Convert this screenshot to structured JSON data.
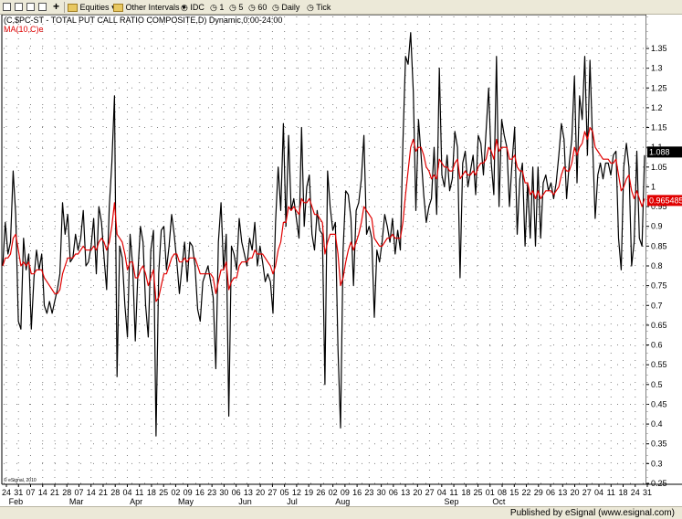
{
  "toolbar": {
    "equities": "Equities",
    "other_intervals": "Other Intervals",
    "idc": "IDC",
    "i1": "1",
    "i5": "5",
    "i60": "60",
    "daily": "Daily",
    "tick": "Tick"
  },
  "footer": {
    "published": "Published by eSignal (www.esignal.com)"
  },
  "colors": {
    "price": "#000000",
    "ma": "#e00000",
    "grid": "#808080"
  },
  "chart_data": {
    "type": "line",
    "title": "(C,$PC-ST - TOTAL PUT CALL RATIO COMPOSITE,D) Dynamic,0:00-24:00",
    "ma_label": "MA(10,C)e",
    "watermark": "© eSignal, 2010",
    "ylim": [
      0.25,
      1.4
    ],
    "y_ticks": [
      "0.25",
      "0.3",
      "0.35",
      "0.4",
      "0.45",
      "0.5",
      "0.55",
      "0.6",
      "0.65",
      "0.7",
      "0.75",
      "0.8",
      "0.85",
      "0.9",
      "0.95",
      "1",
      "1.05",
      "1.1",
      "1.15",
      "1.2",
      "1.25",
      "1.3",
      "1.35"
    ],
    "day_labels": [
      "24",
      "31",
      "07",
      "14",
      "21",
      "28",
      "07",
      "14",
      "21",
      "28",
      "04",
      "11",
      "18",
      "25",
      "02",
      "09",
      "16",
      "23",
      "30",
      "06",
      "13",
      "20",
      "27",
      "05",
      "12",
      "19",
      "26",
      "02",
      "09",
      "16",
      "23",
      "30",
      "06",
      "13",
      "20",
      "27",
      "04",
      "11",
      "18",
      "25",
      "01",
      "08",
      "15",
      "22",
      "29",
      "06",
      "13",
      "20",
      "27",
      "04",
      "11",
      "18",
      "24",
      "31"
    ],
    "month_labels": [
      {
        "label": "Feb",
        "after_day": 0
      },
      {
        "label": "Mar",
        "after_day": 5
      },
      {
        "label": "Apr",
        "after_day": 10
      },
      {
        "label": "May",
        "after_day": 14
      },
      {
        "label": "Jun",
        "after_day": 19
      },
      {
        "label": "Jul",
        "after_day": 23
      },
      {
        "label": "Aug",
        "after_day": 27
      },
      {
        "label": "Sep",
        "after_day": 36
      },
      {
        "label": "Oct",
        "after_day": 40
      }
    ],
    "last_value": "1.088",
    "last_ma": "0.965485",
    "series": [
      {
        "name": "Total Put/Call Ratio",
        "values": [
          0.8,
          0.91,
          0.83,
          0.86,
          1.04,
          0.93,
          0.66,
          0.64,
          0.87,
          0.79,
          0.83,
          0.64,
          0.77,
          0.84,
          0.79,
          0.83,
          0.7,
          0.68,
          0.71,
          0.68,
          0.71,
          0.74,
          0.78,
          0.96,
          0.88,
          0.93,
          0.81,
          0.82,
          0.88,
          0.84,
          0.87,
          0.94,
          0.8,
          0.81,
          0.85,
          0.92,
          0.78,
          0.95,
          0.91,
          0.82,
          0.74,
          0.95,
          1.06,
          1.23,
          0.52,
          0.85,
          0.82,
          0.7,
          0.62,
          0.88,
          0.8,
          0.61,
          0.78,
          0.9,
          0.86,
          0.7,
          0.62,
          0.84,
          0.89,
          0.37,
          0.78,
          0.89,
          0.9,
          0.79,
          0.85,
          0.93,
          0.88,
          0.81,
          0.73,
          0.8,
          0.86,
          0.76,
          0.86,
          0.85,
          0.8,
          0.69,
          0.66,
          0.76,
          0.78,
          0.8,
          0.76,
          0.72,
          0.54,
          0.86,
          0.96,
          0.79,
          0.88,
          0.42,
          0.85,
          0.83,
          0.79,
          0.92,
          0.86,
          0.83,
          0.8,
          0.87,
          0.84,
          0.91,
          0.8,
          0.85,
          0.81,
          0.76,
          0.78,
          0.76,
          0.68,
          0.91,
          1.05,
          0.94,
          1.16,
          0.9,
          1.13,
          0.94,
          0.97,
          0.92,
          0.87,
          1.15,
          0.9,
          1.0,
          1.03,
          0.88,
          0.84,
          0.94,
          0.89,
          0.88,
          0.5,
          1.04,
          0.95,
          0.89,
          0.91,
          0.59,
          0.39,
          0.84,
          0.99,
          0.98,
          0.92,
          0.75,
          0.94,
          0.96,
          1.02,
          1.13,
          0.88,
          0.9,
          0.87,
          0.67,
          0.84,
          0.81,
          0.86,
          0.93,
          0.9,
          0.86,
          0.92,
          0.83,
          0.89,
          0.84,
          1.11,
          1.33,
          1.31,
          1.39,
          1.24,
          0.94,
          1.17,
          1.08,
          0.98,
          0.91,
          0.95,
          0.97,
          1.1,
          0.93,
          1.3,
          1.03,
          1.0,
          1.08,
          0.99,
          1.02,
          1.14,
          1.1,
          0.77,
          1.06,
          1.09,
          1.0,
          1.04,
          1.08,
          0.98,
          1.13,
          1.11,
          1.03,
          1.14,
          1.25,
          1.06,
          0.98,
          1.33,
          0.95,
          1.17,
          1.13,
          1.1,
          0.95,
          1.06,
          1.15,
          0.88,
          1.02,
          1.06,
          0.85,
          1.01,
          0.87,
          1.05,
          0.85,
          1.05,
          0.87,
          1.01,
          1.03,
          0.99,
          1.01,
          0.97,
          1.01,
          1.08,
          1.16,
          1.12,
          0.97,
          1.06,
          1.12,
          1.28,
          1.01,
          1.23,
          1.17,
          1.33,
          1.08,
          1.32,
          1.11,
          0.92,
          1.03,
          1.06,
          1.02,
          1.06,
          1.06,
          1.03,
          1.08,
          1.09,
          0.87,
          0.79,
          1.05,
          1.11,
          1.05,
          0.8,
          0.86,
          1.09,
          0.87,
          0.85,
          1.08
        ]
      },
      {
        "name": "MA(10,C)e",
        "values": [
          0.8,
          0.82,
          0.82,
          0.83,
          0.87,
          0.88,
          0.84,
          0.8,
          0.81,
          0.8,
          0.81,
          0.78,
          0.78,
          0.79,
          0.79,
          0.79,
          0.77,
          0.76,
          0.75,
          0.74,
          0.73,
          0.73,
          0.74,
          0.78,
          0.8,
          0.82,
          0.82,
          0.82,
          0.83,
          0.83,
          0.84,
          0.85,
          0.84,
          0.84,
          0.84,
          0.85,
          0.84,
          0.86,
          0.87,
          0.86,
          0.84,
          0.86,
          0.9,
          0.96,
          0.88,
          0.87,
          0.86,
          0.83,
          0.79,
          0.81,
          0.81,
          0.77,
          0.77,
          0.79,
          0.8,
          0.78,
          0.75,
          0.77,
          0.79,
          0.71,
          0.72,
          0.75,
          0.78,
          0.78,
          0.8,
          0.82,
          0.83,
          0.83,
          0.81,
          0.81,
          0.82,
          0.81,
          0.82,
          0.82,
          0.82,
          0.8,
          0.78,
          0.78,
          0.78,
          0.78,
          0.78,
          0.77,
          0.73,
          0.76,
          0.79,
          0.79,
          0.81,
          0.74,
          0.76,
          0.77,
          0.77,
          0.8,
          0.81,
          0.81,
          0.81,
          0.82,
          0.82,
          0.84,
          0.83,
          0.83,
          0.83,
          0.82,
          0.81,
          0.8,
          0.78,
          0.8,
          0.84,
          0.86,
          0.91,
          0.91,
          0.95,
          0.94,
          0.95,
          0.94,
          0.93,
          0.97,
          0.96,
          0.96,
          0.97,
          0.95,
          0.93,
          0.93,
          0.92,
          0.91,
          0.83,
          0.86,
          0.88,
          0.88,
          0.88,
          0.83,
          0.75,
          0.77,
          0.81,
          0.84,
          0.86,
          0.84,
          0.86,
          0.88,
          0.91,
          0.95,
          0.94,
          0.93,
          0.92,
          0.87,
          0.86,
          0.85,
          0.85,
          0.86,
          0.87,
          0.87,
          0.88,
          0.87,
          0.87,
          0.87,
          0.91,
          0.98,
          1.04,
          1.1,
          1.12,
          1.09,
          1.1,
          1.1,
          1.08,
          1.05,
          1.04,
          1.02,
          1.03,
          1.02,
          1.07,
          1.06,
          1.05,
          1.05,
          1.04,
          1.04,
          1.06,
          1.07,
          1.02,
          1.03,
          1.04,
          1.03,
          1.03,
          1.04,
          1.03,
          1.05,
          1.06,
          1.06,
          1.07,
          1.1,
          1.09,
          1.07,
          1.12,
          1.09,
          1.1,
          1.1,
          1.1,
          1.07,
          1.07,
          1.08,
          1.05,
          1.04,
          1.04,
          1.01,
          1.01,
          0.98,
          0.99,
          0.97,
          0.99,
          0.97,
          0.98,
          0.99,
          0.99,
          0.99,
          0.98,
          0.99,
          1.0,
          1.03,
          1.05,
          1.04,
          1.04,
          1.06,
          1.1,
          1.08,
          1.1,
          1.11,
          1.14,
          1.12,
          1.15,
          1.14,
          1.1,
          1.09,
          1.08,
          1.07,
          1.07,
          1.07,
          1.06,
          1.06,
          1.07,
          1.03,
          0.99,
          1.0,
          1.02,
          1.03,
          0.99,
          0.97,
          0.99,
          0.97,
          0.95,
          0.97
        ]
      }
    ]
  }
}
